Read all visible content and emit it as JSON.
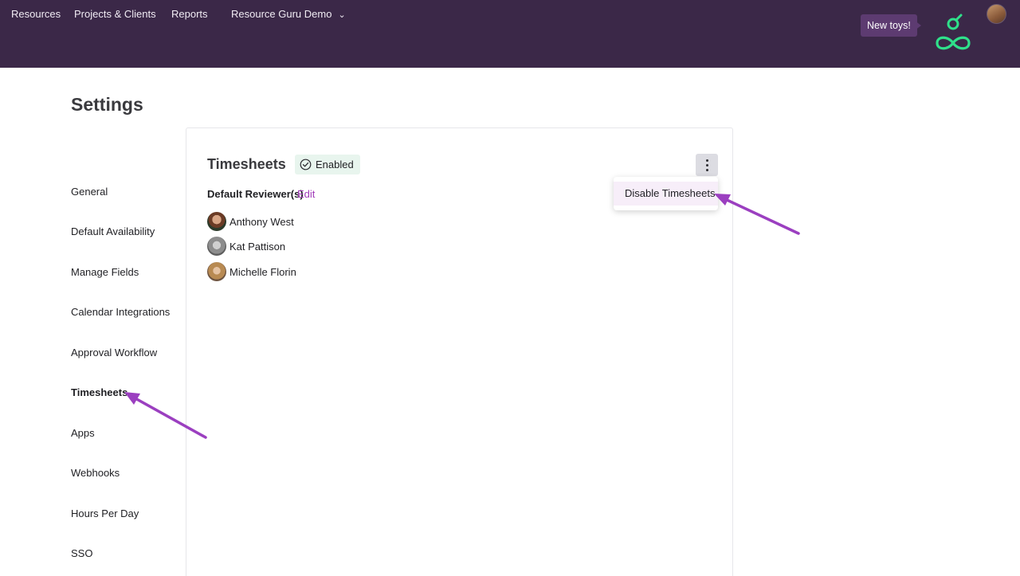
{
  "nav": {
    "resources": "Resources",
    "projects_clients": "Projects & Clients",
    "reports": "Reports",
    "account": "Resource Guru Demo",
    "new_toys": "New toys!"
  },
  "page": {
    "title": "Settings"
  },
  "sidebar": {
    "items": [
      {
        "label": "General"
      },
      {
        "label": "Default Availability"
      },
      {
        "label": "Manage Fields"
      },
      {
        "label": "Calendar Integrations"
      },
      {
        "label": "Approval Workflow"
      },
      {
        "label": "Timesheets",
        "active": true
      },
      {
        "label": "Apps"
      },
      {
        "label": "Webhooks"
      },
      {
        "label": "Hours Per Day"
      },
      {
        "label": "SSO"
      }
    ]
  },
  "timesheets": {
    "title": "Timesheets",
    "status": "Enabled",
    "menu": {
      "disable_label": "Disable Timesheets"
    },
    "reviewers_label": "Default Reviewer(s)",
    "edit_label": "Edit",
    "reviewers": [
      {
        "name": "Anthony West"
      },
      {
        "name": "Kat Pattison"
      },
      {
        "name": "Michelle Florin"
      }
    ]
  },
  "colors": {
    "topbar": "#3b2848",
    "accent": "#a03ab8",
    "logo": "#2fe08a",
    "enabled_badge_bg": "#e8f5ee",
    "annotation_arrow": "#9b3fc0"
  }
}
